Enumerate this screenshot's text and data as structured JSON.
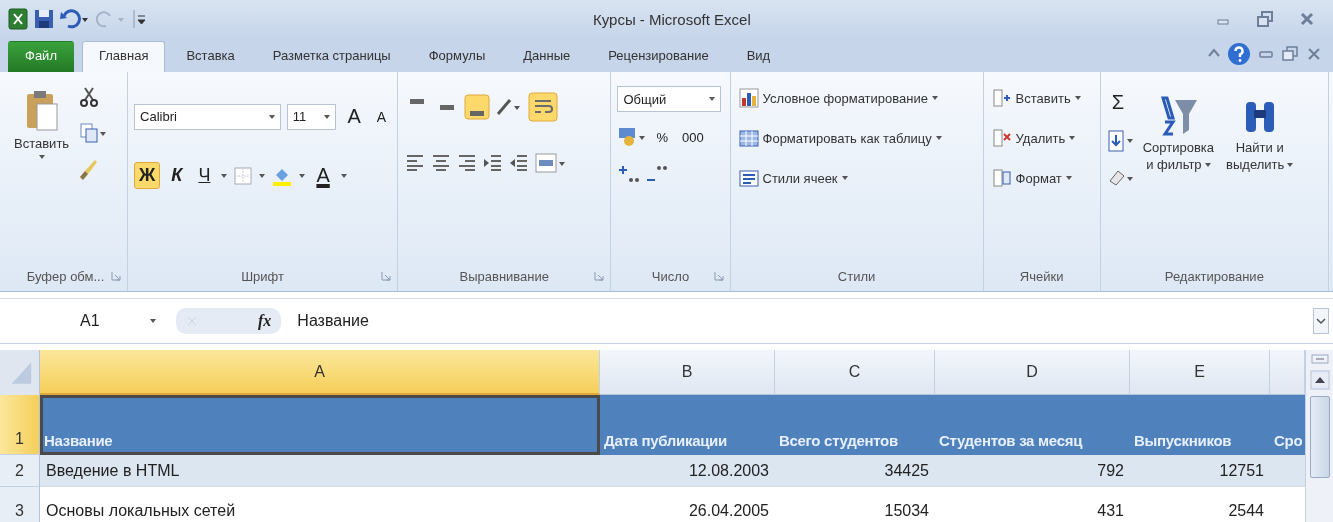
{
  "window": {
    "title": "Курсы - Microsoft Excel"
  },
  "tabs": [
    {
      "label": "Файл",
      "kind": "file",
      "selected": false
    },
    {
      "label": "Главная",
      "kind": "tab",
      "selected": true
    },
    {
      "label": "Вставка",
      "kind": "tab",
      "selected": false
    },
    {
      "label": "Разметка страницы",
      "kind": "tab",
      "selected": false
    },
    {
      "label": "Формулы",
      "kind": "tab",
      "selected": false
    },
    {
      "label": "Данные",
      "kind": "tab",
      "selected": false
    },
    {
      "label": "Рецензирование",
      "kind": "tab",
      "selected": false
    },
    {
      "label": "Вид",
      "kind": "tab",
      "selected": false
    }
  ],
  "ribbon": {
    "clipboard": {
      "name": "Буфер обм...",
      "paste": "Вставить"
    },
    "font": {
      "name": "Шрифт",
      "family": "Calibri",
      "size": "11",
      "grow": "A",
      "shrink": "A",
      "font_color": "A",
      "style_buttons": [
        {
          "label": "Ж",
          "selected": true
        },
        {
          "label": "К",
          "selected": false
        },
        {
          "label": "Ч",
          "selected": false
        }
      ]
    },
    "alignment": {
      "name": "Выравнивание",
      "vertical": [
        {
          "selected": false
        },
        {
          "selected": false
        },
        {
          "selected": true
        }
      ],
      "wrap_selected": true
    },
    "number": {
      "name": "Число",
      "format": "Общий",
      "percent": "%",
      "thousands": "000"
    },
    "styles": {
      "name": "Стили",
      "items": [
        "Условное форматирование",
        "Форматировать как таблицу",
        "Стили ячеек"
      ]
    },
    "cells": {
      "name": "Ячейки",
      "items": [
        "Вставить",
        "Удалить",
        "Формат"
      ]
    },
    "editing": {
      "name": "Редактирование",
      "sum": "Σ",
      "sort": [
        "Сортировка",
        "и фильтр"
      ],
      "find": [
        "Найти и",
        "выделить"
      ]
    }
  },
  "formula_bar": {
    "name_box": "A1",
    "function_label": "fx",
    "formula": "Название"
  },
  "sheet": {
    "columns": [
      {
        "label": "A",
        "kind": "text",
        "selected": true
      },
      {
        "label": "B",
        "kind": "number",
        "selected": false
      },
      {
        "label": "C",
        "kind": "number",
        "selected": false
      },
      {
        "label": "D",
        "kind": "number",
        "selected": false
      },
      {
        "label": "E",
        "kind": "number",
        "selected": false
      },
      {
        "kind": "number",
        "selected": false
      }
    ],
    "rows": [
      {
        "number": "1",
        "kind": "header",
        "selected": true,
        "cells": [
          "Название",
          "Дата публикации",
          "Всего студентов",
          "Студентов за месяц",
          "Выпускников",
          "Сро"
        ]
      },
      {
        "number": "2",
        "kind": "band",
        "selected": false,
        "cells": [
          "Введение в HTML",
          "12.08.2003",
          "34425",
          "792",
          "12751"
        ]
      },
      {
        "number": "3",
        "kind": "plain",
        "selected": false,
        "cells": [
          "Основы локальных сетей",
          "26.04.2005",
          "15034",
          "431",
          "2544"
        ]
      }
    ]
  }
}
